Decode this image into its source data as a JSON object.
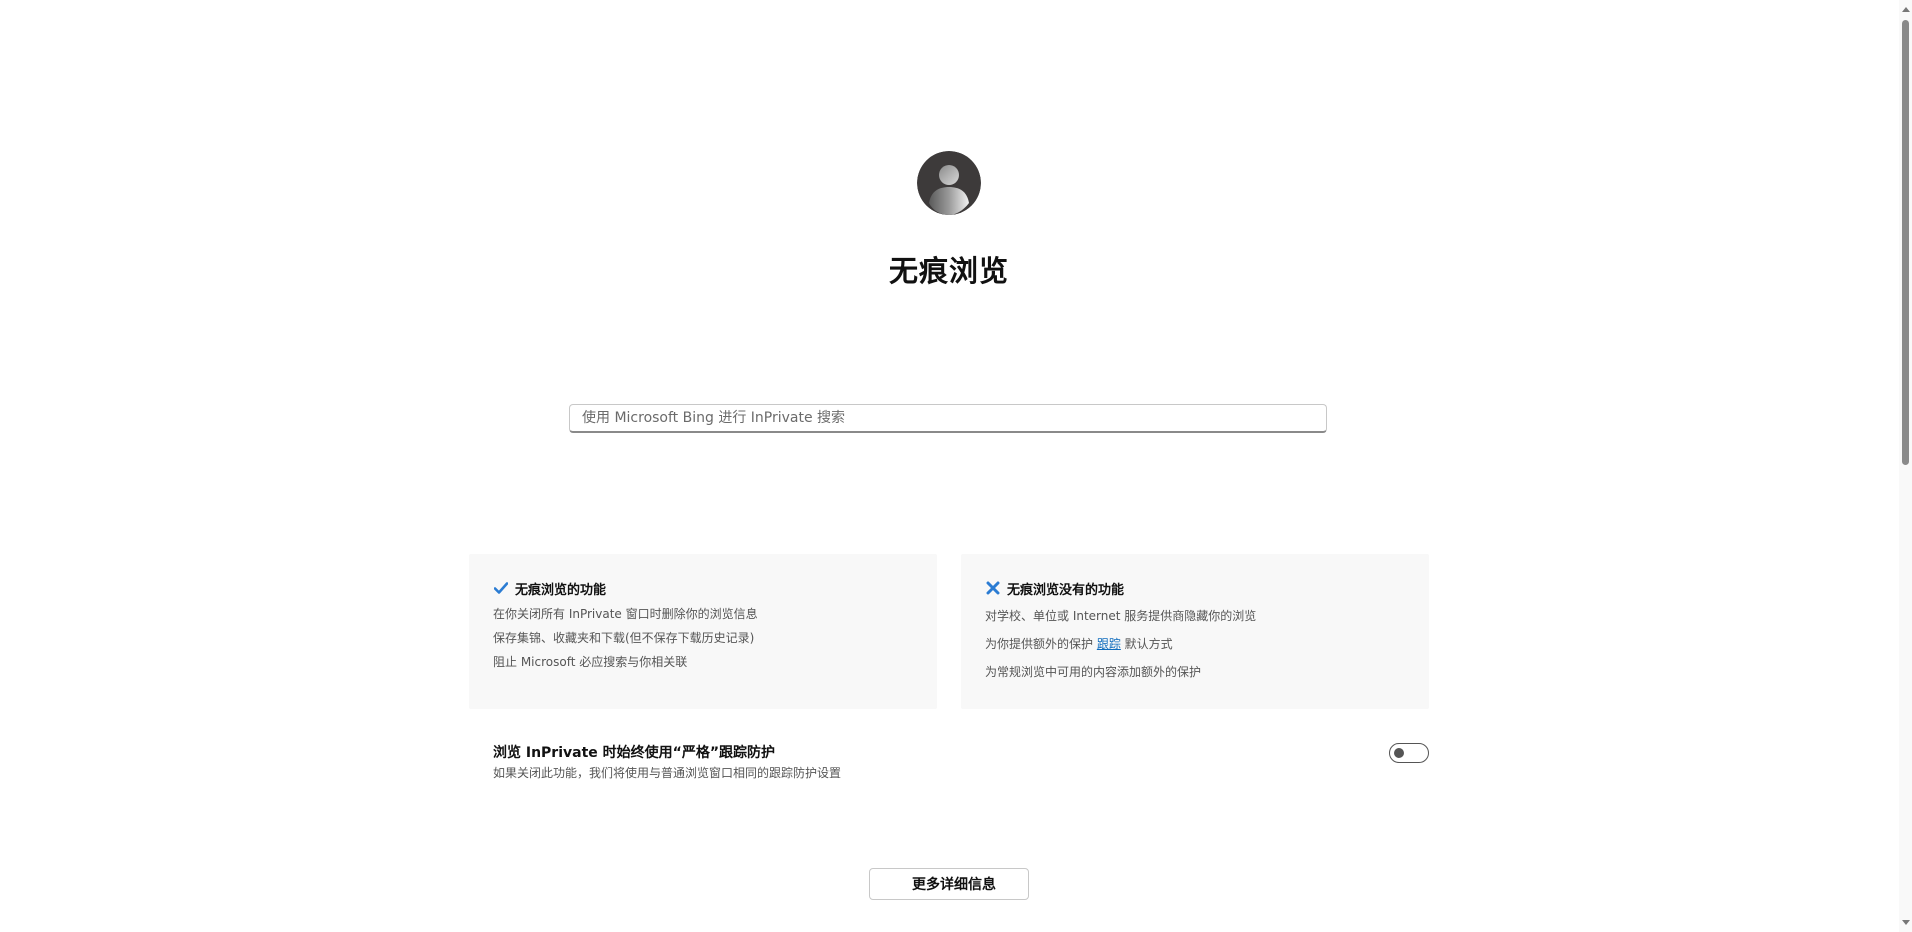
{
  "header": {
    "avatar_icon": "user-avatar-icon",
    "title": "无痕浏览"
  },
  "search": {
    "placeholder": "使用 Microsoft Bing 进行 InPrivate 搜索"
  },
  "features_card": {
    "icon": "checkmark-icon",
    "icon_color": "#2b7cd3",
    "title": "无痕浏览的功能",
    "items": [
      "在你关闭所有 InPrivate 窗口时删除你的浏览信息",
      "保存集锦、收藏夹和下载(但不保存下载历史记录)",
      "阻止 Microsoft 必应搜索与你相关联"
    ]
  },
  "limits_card": {
    "icon": "x-icon",
    "icon_color": "#2b7cd3",
    "title": "无痕浏览没有的功能",
    "item1": "对学校、单位或 Internet 服务提供商隐藏你的浏览",
    "item2_prefix": "为你提供额外的保护 ",
    "item2_link": "跟踪",
    "item2_suffix": " 默认方式",
    "item3": "为常规浏览中可用的内容添加额外的保护"
  },
  "strict_tracking": {
    "title": "浏览 InPrivate 时始终使用“严格”跟踪防护",
    "description": "如果关闭此功能，我们将使用与普通浏览窗口相同的跟踪防护设置",
    "enabled": false
  },
  "more_button": {
    "label": "更多详细信息"
  }
}
